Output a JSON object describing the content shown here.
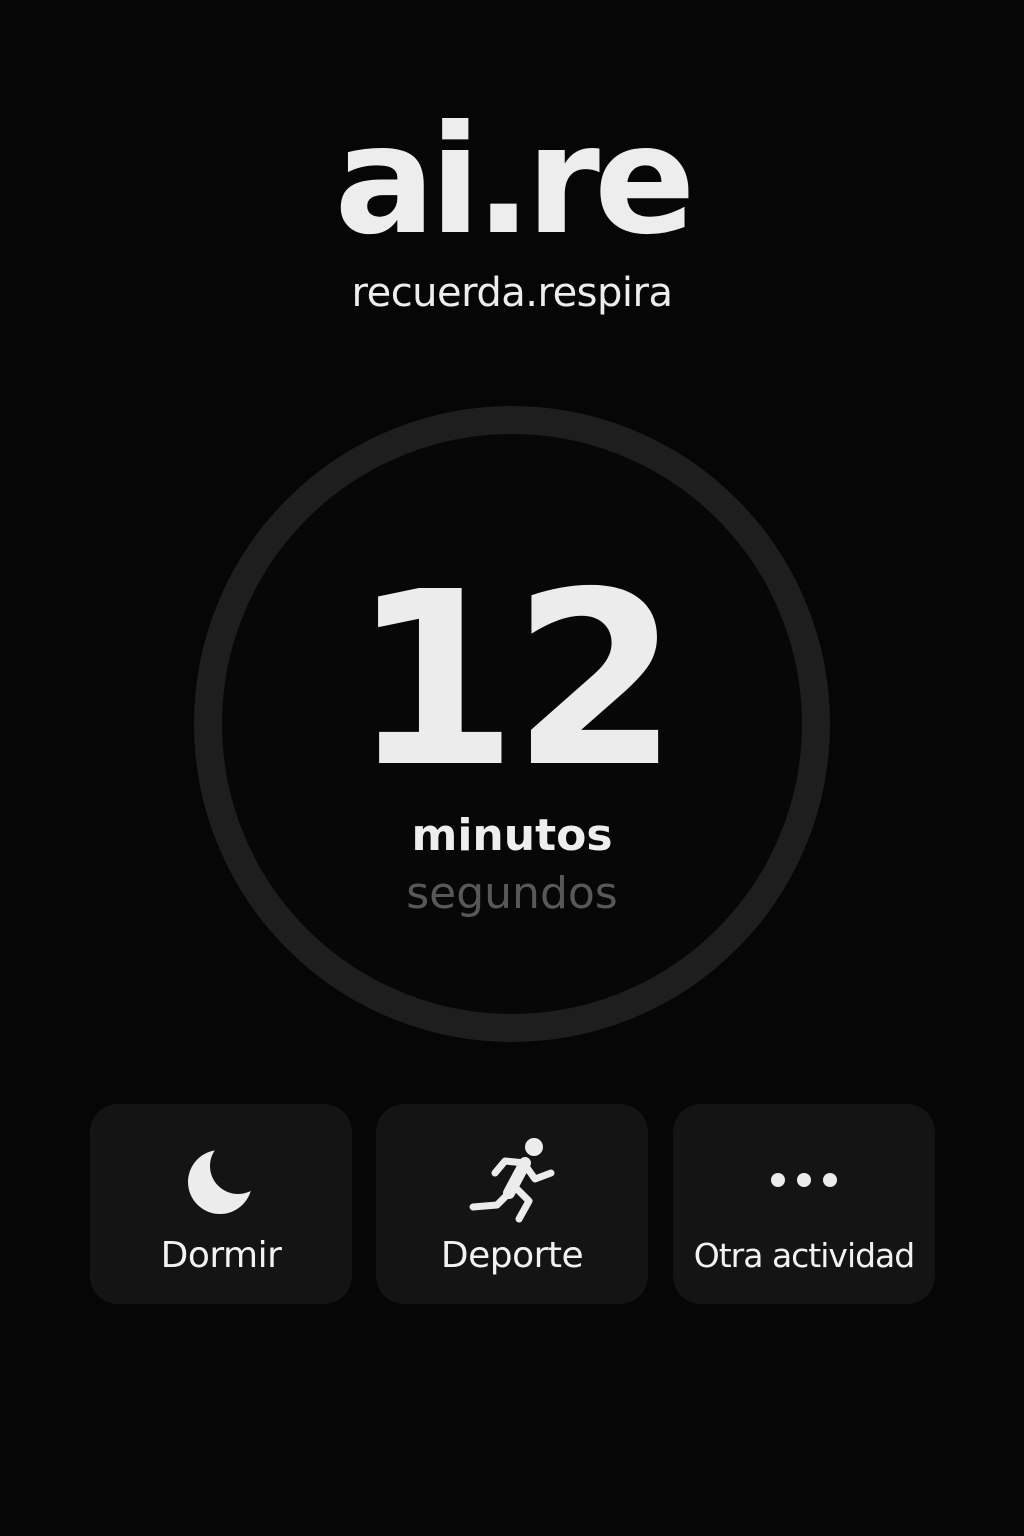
{
  "app": {
    "logo": "ai.re",
    "tagline": "recuerda.respira"
  },
  "timer": {
    "value": "12",
    "unit_primary": "minutos",
    "unit_secondary": "segundos"
  },
  "activities": [
    {
      "label": "Dormir",
      "icon": "moon-icon"
    },
    {
      "label": "Deporte",
      "icon": "running-person-icon"
    },
    {
      "label": "Otra actividad",
      "icon": "more-dots-icon"
    }
  ],
  "colors": {
    "background": "#060606",
    "ring": "#1e1e1e",
    "card": "#141414",
    "text": "#ececec",
    "muted_text": "#585858"
  }
}
